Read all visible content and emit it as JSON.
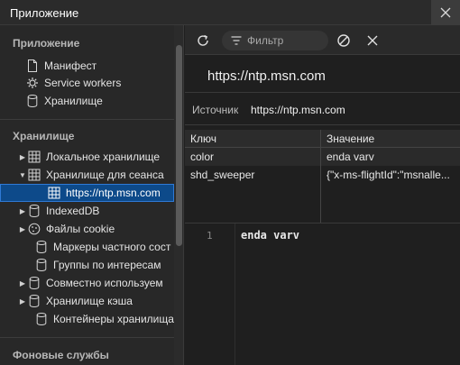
{
  "window": {
    "title": "Приложение"
  },
  "sidebar": {
    "sections": [
      {
        "title": "Приложение"
      },
      {
        "title": "Хранилище"
      },
      {
        "title": "Фоновые службы"
      }
    ],
    "app_items": [
      {
        "label": "Манифест",
        "icon": "document-icon"
      },
      {
        "label": "Service workers",
        "icon": "gear-icon"
      },
      {
        "label": "Хранилище",
        "icon": "database-icon"
      }
    ],
    "storage_items": [
      {
        "label": "Локальное хранилище",
        "icon": "table-icon",
        "expand": "collapsed"
      },
      {
        "label": "Хранилище для сеанса",
        "icon": "table-icon",
        "expand": "expanded"
      },
      {
        "label": "https://ntp.msn.com",
        "icon": "table-icon",
        "selected": true
      },
      {
        "label": "IndexedDB",
        "icon": "database-icon",
        "expand": "collapsed"
      },
      {
        "label": "Файлы cookie",
        "icon": "cookie-icon",
        "expand": "collapsed"
      },
      {
        "label": "Маркеры частного сост",
        "icon": "database-icon"
      },
      {
        "label": "Группы по интересам",
        "icon": "database-icon"
      },
      {
        "label": "Совместно используем",
        "icon": "database-icon",
        "expand": "collapsed"
      },
      {
        "label": "Хранилище кэша",
        "icon": "database-icon",
        "expand": "collapsed"
      },
      {
        "label": "Контейнеры хранилища",
        "icon": "database-icon"
      }
    ]
  },
  "toolbar": {
    "filter_placeholder": "Фильтр",
    "refresh_icon": "refresh-icon",
    "clear_icon": "clear-icon",
    "delete_icon": "close-icon"
  },
  "main": {
    "origin": "https://ntp.msn.com",
    "source_label": "Источник",
    "source_value": "https://ntp.msn.com"
  },
  "table": {
    "columns": [
      "Ключ",
      "Значение"
    ],
    "rows": [
      {
        "key": "color",
        "value": "enda varv"
      },
      {
        "key": "shd_sweeper",
        "value": "{\"x-ms-flightId\":\"msnalle..."
      }
    ]
  },
  "editor": {
    "line_number": "1",
    "content": "enda varv"
  },
  "colors": {
    "selected_bg": "#0d4a8a",
    "accent": "#2f7ad6"
  }
}
